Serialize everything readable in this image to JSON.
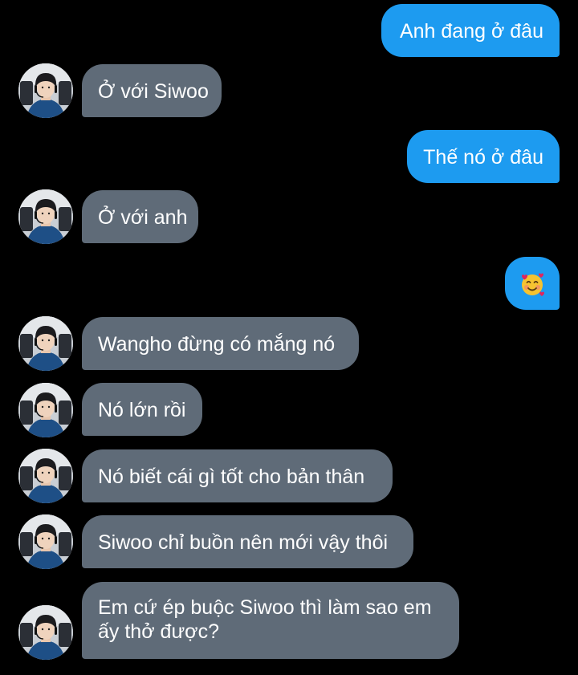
{
  "colors": {
    "background": "#000000",
    "outgoing_bubble": "#1d9bf0",
    "incoming_bubble": "#5f6b78",
    "text": "#ffffff"
  },
  "avatar": {
    "icon": "user-avatar-photo"
  },
  "messages": [
    {
      "direction": "outgoing",
      "text": "Anh đang ở đâu"
    },
    {
      "direction": "incoming",
      "text": "Ở với Siwoo"
    },
    {
      "direction": "outgoing",
      "text": "Thế nó ở đâu"
    },
    {
      "direction": "incoming",
      "text": "Ở với anh"
    },
    {
      "direction": "outgoing",
      "emoji": "smiling-face-with-hearts-icon"
    },
    {
      "direction": "incoming",
      "text": "Wangho đừng có mắng nó"
    },
    {
      "direction": "incoming",
      "text": "Nó lớn rồi"
    },
    {
      "direction": "incoming",
      "text": "Nó biết cái gì tốt cho bản thân"
    },
    {
      "direction": "incoming",
      "text": "Siwoo chỉ buồn nên mới vậy thôi"
    },
    {
      "direction": "incoming",
      "text": "Em cứ ép buộc Siwoo thì làm sao em ấy thở được?"
    }
  ]
}
